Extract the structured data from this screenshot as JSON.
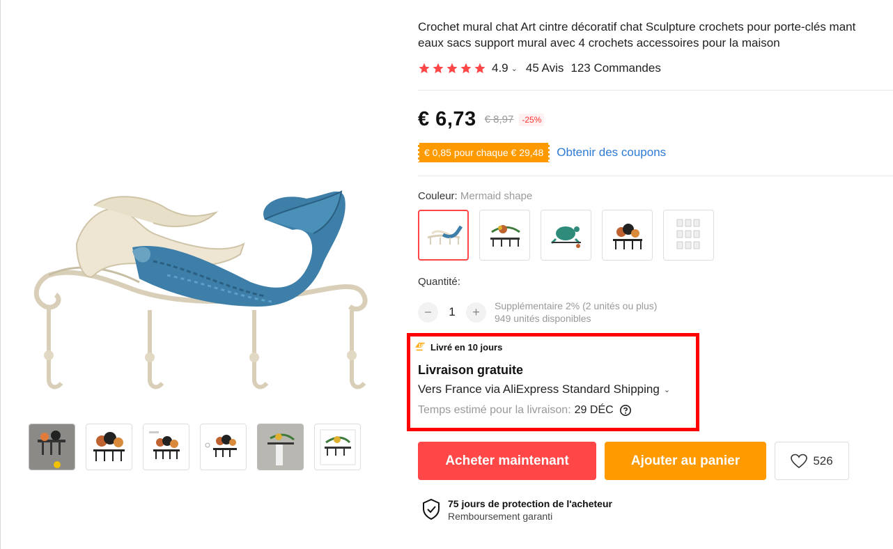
{
  "product": {
    "title_line1": "Crochet mural chat Art cintre décoratif chat Sculpture crochets pour porte-clés mant",
    "title_line2": "eaux sacs support mural avec 4 crochets accessoires pour la maison",
    "rating": "4.9",
    "rating_chevron": "⌄",
    "reviews": "45 Avis",
    "orders": "123 Commandes"
  },
  "pricing": {
    "price": "€ 6,73",
    "old_price": "€ 8,97",
    "discount": "-25%",
    "coupon_badge": "€ 0,85 pour chaque € 29,48",
    "coupon_link": "Obtenir des coupons"
  },
  "variants": {
    "color_label": "Couleur:",
    "color_value": "Mermaid shape",
    "swatches": [
      "mermaid",
      "bird",
      "turtle",
      "cats",
      "hooks-set"
    ],
    "selected_index": 0
  },
  "quantity": {
    "label": "Quantité:",
    "minus": "−",
    "value": "1",
    "plus": "+",
    "extra": "Supplémentaire 2% (2 unités ou plus)",
    "available": "949 unités disponibles"
  },
  "shipping": {
    "badge": "Livré en 10 jours",
    "free": "Livraison gratuite",
    "route": "Vers France via AliExpress Standard Shipping",
    "time_label": "Temps estimé pour la livraison:",
    "time_date": "29 DÉC"
  },
  "actions": {
    "buy_now": "Acheter maintenant",
    "add_to_cart": "Ajouter au panier",
    "wishlist_count": "526"
  },
  "protection": {
    "title": "75 jours de protection de l'acheteur",
    "subtitle": "Remboursement garanti"
  },
  "gallery": {
    "thumbnails": [
      "cats-photo",
      "cats-hook-1",
      "cats-hook-2",
      "cats-hook-3",
      "bird-hook-photo",
      "bird-hook"
    ]
  },
  "colors": {
    "accent_red": "#ff4747",
    "accent_orange": "#ff9a00",
    "link_blue": "#2e7bd6",
    "star": "#ff4747"
  }
}
